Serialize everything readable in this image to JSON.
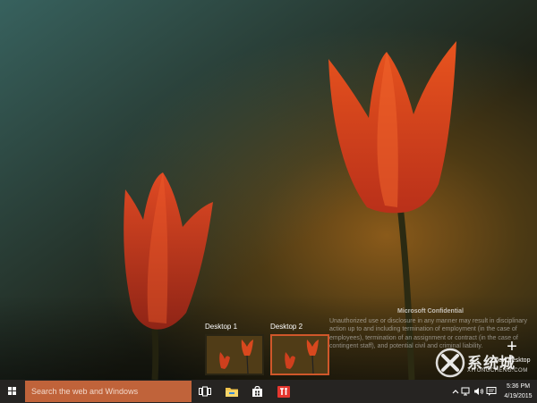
{
  "watermark": {
    "title": "Microsoft Confidential",
    "body": "Unauthorized use or disclosure in any manner may result in disciplinary action up to and including termination of employment (in the case of employees), termination of an assignment or contract (in the case of contingent staff), and potential civil and criminal liability."
  },
  "task_view": {
    "desktops": [
      {
        "label": "Desktop 1",
        "active": false
      },
      {
        "label": "Desktop 2",
        "active": true
      }
    ],
    "new_desktop_label": "New desktop",
    "new_desktop_symbol": "+"
  },
  "taskbar": {
    "search_placeholder": "Search the web and Windows",
    "search_color": "#c0633a",
    "pinned": [
      {
        "name": "task-view-icon"
      },
      {
        "name": "file-explorer-icon"
      },
      {
        "name": "store-icon"
      },
      {
        "name": "app-icon"
      }
    ],
    "tray": {
      "icons": [
        "chevron-up-icon",
        "network-icon",
        "volume-icon",
        "action-center-icon"
      ],
      "time": "5:36 PM",
      "date": "4/19/2015"
    }
  },
  "brand": {
    "text": "系统城",
    "sub": "XITONGCHENG.COM"
  },
  "colors": {
    "accent": "#d0572a",
    "taskbar": "#262422"
  }
}
